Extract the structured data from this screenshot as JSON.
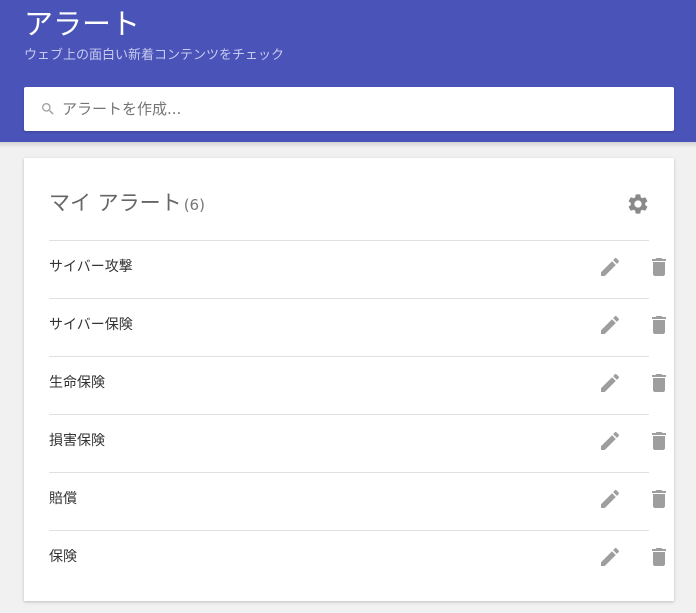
{
  "header": {
    "title": "アラート",
    "subtitle": "ウェブ上の面白い新着コンテンツをチェック",
    "background_color": "#4a53b8"
  },
  "search": {
    "placeholder": "アラートを作成...",
    "value": "",
    "icon": "search-icon"
  },
  "my_alerts": {
    "title": "マイ アラート",
    "count": "(6)",
    "settings_icon": "gear-icon",
    "items": [
      {
        "label": "サイバー攻撃"
      },
      {
        "label": "サイバー保険"
      },
      {
        "label": "生命保険"
      },
      {
        "label": "損害保険"
      },
      {
        "label": "賠償"
      },
      {
        "label": "保険"
      }
    ],
    "edit_icon": "pencil-icon",
    "delete_icon": "trash-icon"
  }
}
